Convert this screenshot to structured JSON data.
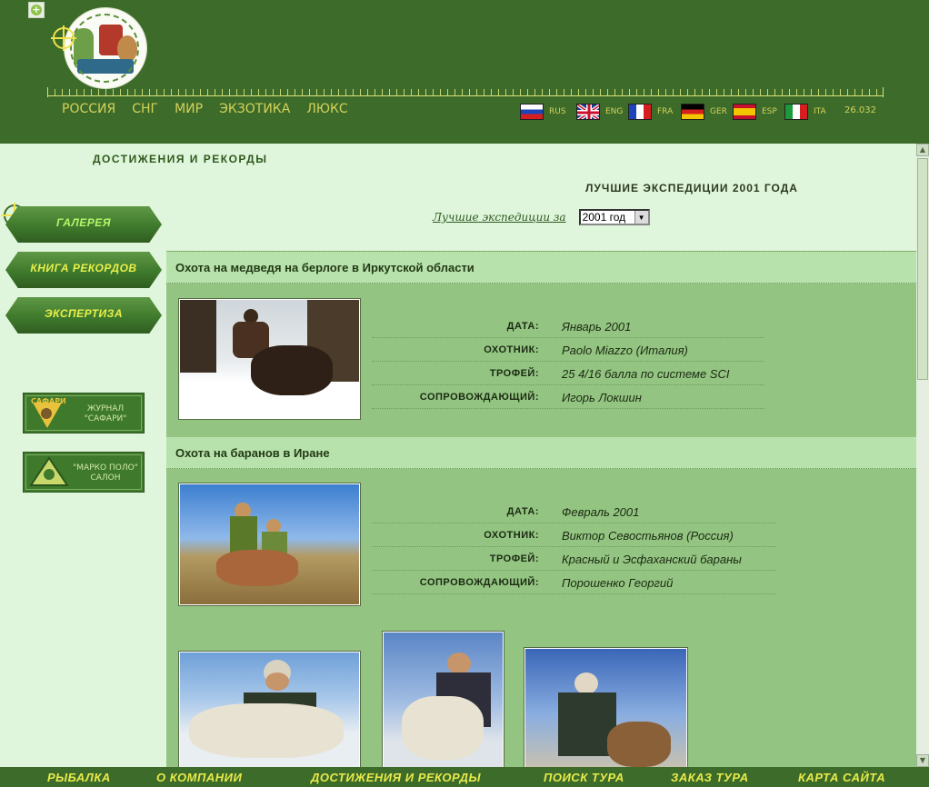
{
  "top_nav": [
    "РОССИЯ",
    "СНГ",
    "МИР",
    "ЭКЗОТИКА",
    "ЛЮКС"
  ],
  "languages": [
    {
      "code": "RUS",
      "flag": "russia-flag-icon"
    },
    {
      "code": "ENG",
      "flag": "uk-flag-icon"
    },
    {
      "code": "FRA",
      "flag": "france-flag-icon"
    },
    {
      "code": "GER",
      "flag": "germany-flag-icon"
    },
    {
      "code": "ESP",
      "flag": "spain-flag-icon"
    },
    {
      "code": "ITA",
      "flag": "italy-flag-icon"
    }
  ],
  "date_code": "26.032",
  "section_title": "ДОСТИЖЕНИЯ И РЕКОРДЫ",
  "subtitle": "ЛУЧШИЕ ЭКСПЕДИЦИИ 2001 ГОДА",
  "year_selector": {
    "label": "Лучшие экспедиции за",
    "value": "2001 год"
  },
  "side_menu": [
    "ГАЛЕРЕЯ",
    "КНИГА РЕКОРДОВ",
    "ЭКСПЕРТИЗА"
  ],
  "promos": [
    {
      "brand": "САФАРИ",
      "line1": "ЖУРНАЛ",
      "line2": "\"САФАРИ\""
    },
    {
      "line1": "\"МАРКО ПОЛО\"",
      "line2": "САЛОН"
    }
  ],
  "entries": [
    {
      "title": "Охота на медведя на берлоге в Иркутской области",
      "rows": [
        {
          "key": "ДАТА:",
          "value": "Январь 2001"
        },
        {
          "key": "ОХОТНИК:",
          "value": "Paolo Miazzo (Италия)"
        },
        {
          "key": "ТРОФЕЙ:",
          "value": "25 4/16 балла по системе SCI"
        },
        {
          "key": "СОПРОВОЖДАЮЩИЙ:",
          "value": "Игорь Локшин"
        }
      ]
    },
    {
      "title": "Охота на баранов в Иране",
      "rows": [
        {
          "key": "ДАТА:",
          "value": "Февраль 2001"
        },
        {
          "key": "ОХОТНИК:",
          "value": "Виктор Севостьянов (Россия)"
        },
        {
          "key": "ТРОФЕЙ:",
          "value": "Красный и Эсфаханский бараны"
        },
        {
          "key": "СОПРОВОЖДАЮЩИЙ:",
          "value": "Порошенко Георгий"
        }
      ]
    }
  ],
  "bottom_nav": [
    "РЫБАЛКА",
    "О КОМПАНИИ",
    "ДОСТИЖЕНИЯ И РЕКОРДЫ",
    "ПОИСК ТУРА",
    "ЗАКАЗ ТУРА",
    "КАРТА САЙТА"
  ],
  "colors": {
    "header": "#3d6b2a",
    "page": "#dff5dc",
    "content": "#93c481",
    "menu_text": "#e8f04a",
    "nav_text": "#d4d25a"
  }
}
